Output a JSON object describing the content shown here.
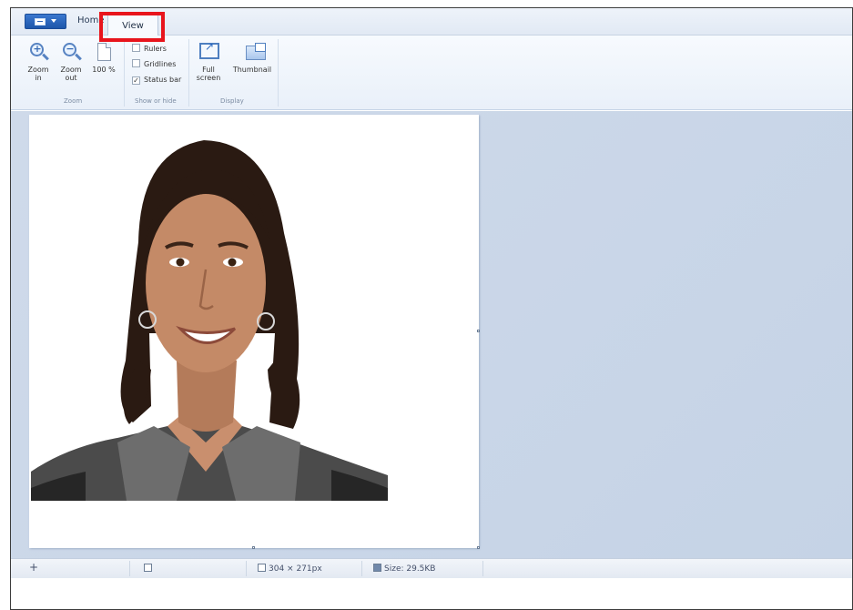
{
  "tabs": {
    "home_label": "Home",
    "view_label": "View"
  },
  "ribbon": {
    "zoom_in_label": "Zoom in",
    "zoom_out_label": "Zoom out",
    "zoom_100_label": "100 %",
    "rulers_label": "Rulers",
    "gridlines_label": "Gridlines",
    "status_bar_label": "Status bar",
    "status_bar_checkmark": "✓",
    "full_screen_label": "Full screen",
    "thumbnail_label": "Thumbnail",
    "groups": {
      "zoom": "Zoom",
      "show_or_hide": "Show or hide",
      "display": "Display"
    },
    "checks": {
      "rulers": false,
      "gridlines": false,
      "status_bar": true
    }
  },
  "statusbar": {
    "move_icon": "+",
    "dimensions": "304 × 271px",
    "size": "Size: 29.5KB"
  },
  "colors": {
    "highlight": "#e8141c",
    "app_menu": "#1d56aa",
    "workspace": "#cfdaea"
  },
  "icons": [
    "app-menu-icon",
    "zoom-in-icon",
    "zoom-out-icon",
    "page-icon",
    "full-screen-icon",
    "thumbnail-icon",
    "move-icon",
    "selection-icon",
    "dimensions-icon",
    "disk-icon"
  ]
}
